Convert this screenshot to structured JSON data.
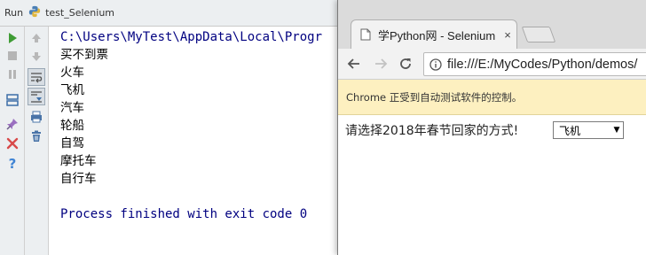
{
  "ide": {
    "run_label": "Run",
    "config_name": "test_Selenium",
    "console": {
      "command": "C:\\Users\\MyTest\\AppData\\Local\\Progr",
      "output": [
        "买不到票",
        "火车",
        "飞机",
        "汽车",
        "轮船",
        "自驾",
        "摩托车",
        "自行车"
      ],
      "exit_message": "Process finished with exit code 0"
    },
    "left_toolbar_icons": [
      "rerun-icon",
      "stop-icon",
      "pause-icon",
      "layout-icon",
      "pin-icon",
      "close-icon",
      "help-icon"
    ],
    "right_toolbar_icons": [
      "up-arrow-icon",
      "down-arrow-icon",
      "soft-wrap-icon",
      "scroll-to-end-icon",
      "print-icon",
      "trash-icon"
    ]
  },
  "browser": {
    "tab_title": "学Python网 - Selenium",
    "tab_close": "×",
    "url": "file:///E:/MyCodes/Python/demos/",
    "infobar_text": "Chrome 正受到自动测试软件的控制。",
    "page": {
      "prompt": "请选择2018年春节回家的方式!",
      "selected_option": "飞机"
    }
  },
  "colors": {
    "console_navy": "#000080",
    "rerun_green": "#3f9c35",
    "infobar_bg": "#fdf0c0",
    "close_red": "#d84a4a",
    "help_blue": "#3f84d4"
  }
}
